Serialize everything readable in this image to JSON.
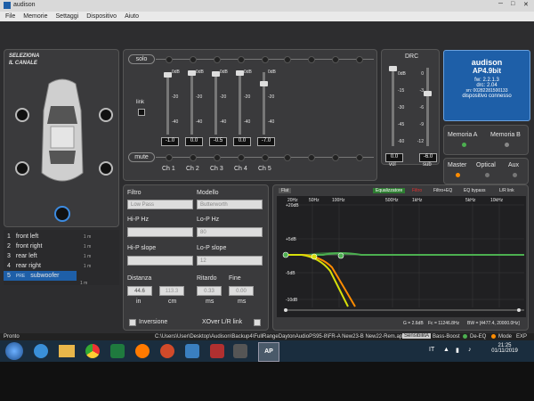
{
  "window": {
    "title": "audison"
  },
  "menu": [
    "File",
    "Memorie",
    "Settaggi",
    "Dispositivo",
    "Aiuto"
  ],
  "channel_select": {
    "title_line1": "SELEZIONA",
    "title_line2": "IL CANALE",
    "channels": [
      {
        "num": "1",
        "name": "front left",
        "meta": "1 m",
        "tag": "ch"
      },
      {
        "num": "2",
        "name": "front right",
        "meta": "1 m",
        "tag": "ch"
      },
      {
        "num": "3",
        "name": "rear left",
        "meta": "1 m",
        "tag": "ch"
      },
      {
        "num": "4",
        "name": "rear right",
        "meta": "1 m",
        "tag": "ch"
      },
      {
        "num": "5",
        "name": "subwoofer",
        "meta": "1 m",
        "tag": "ch",
        "prefix": "PRE"
      }
    ],
    "link_label": "link"
  },
  "mixer": {
    "solo_label": "solo",
    "mute_label": "mute",
    "link_label": "link",
    "scale": [
      "0dB",
      "-20",
      "-40"
    ],
    "channels": [
      {
        "label": "Ch 1",
        "value": "-1.0",
        "level": 0.97
      },
      {
        "label": "Ch 2",
        "value": "0.0",
        "level": 1.0
      },
      {
        "label": "Ch 3",
        "value": "-0.5",
        "level": 0.98
      },
      {
        "label": "Ch 4",
        "value": "0.0",
        "level": 1.0
      },
      {
        "label": "Ch 5",
        "value": "-7.0",
        "level": 0.83
      }
    ]
  },
  "drc": {
    "title": "DRC",
    "scale_left": [
      "0dB",
      "-15",
      "-30",
      "-45",
      "-60"
    ],
    "scale_right": [
      "0",
      "-3",
      "-6",
      "-9",
      "-12"
    ],
    "vol_value": "0.0",
    "sub_value": "-6.0",
    "vol_label": "vol",
    "sub_label": "sub"
  },
  "device": {
    "brand": "audison",
    "model": "AP4.9bit",
    "fw": "fw: 2.2.1.3",
    "drc": "drc: 2.04",
    "sn": "sn: 00282281500133",
    "status": "dispositivo connesso"
  },
  "memory": {
    "a": "Memoria A",
    "b": "Memoria B"
  },
  "input": {
    "master": "Master",
    "optical": "Optical",
    "aux": "Aux"
  },
  "filter": {
    "filtro_label": "Filtro",
    "filtro_value": "Low Pass",
    "modello_label": "Modello",
    "modello_value": "Butterworth",
    "hip_hz_label": "Hi-P Hz",
    "hip_hz_value": "",
    "lop_hz_label": "Lo-P Hz",
    "lop_hz_value": "80",
    "hip_slope_label": "Hi-P slope",
    "hip_slope_value": "",
    "lop_slope_label": "Lo-P slope",
    "lop_slope_value": "12",
    "distanza_label": "Distanza",
    "distanza_in": "44.6",
    "distanza_cm": "113.3",
    "in_label": "in",
    "cm_label": "cm",
    "ritardo_label": "Ritardo",
    "ritardo_value": "0.33",
    "fine_label": "Fine",
    "fine_value": "0.00",
    "ms_label": "ms",
    "inversione_label": "Inversione",
    "xover_label": "XOver L/R link"
  },
  "eq": {
    "tab_flat": "Flat",
    "equalizzatore": "Equalizzatore",
    "filtro": "Filtro",
    "filtro_eq": "Filtro+EQ",
    "eq_bypass": "EQ bypass",
    "lr_link": "L/R link",
    "y_labels": [
      "+20dB",
      "+5dB",
      "-5dB",
      "-10dB"
    ],
    "x_labels": [
      "20Hz",
      "50Hz",
      "100Hz",
      "500Hz",
      "1kHz",
      "5kHz",
      "10kHz"
    ],
    "readout_g": "G = 2.6dB",
    "readout_fc": "Fc = 11246.8Hz",
    "readout_bw": "BW = [4477.4, 20000.0Hz]"
  },
  "status": {
    "left": "Pronto",
    "path": "C:\\Users\\User\\Desktop\\Audison\\Backup4\\FullRangeDaytonAudioPS95-8\\FR-A New23-B New22-Rem.apx",
    "speedbtn": "SensibilitA",
    "bass_boost": "Bass-Boost",
    "de_eq": "De-EQ",
    "mode": "Mode",
    "exp": "EXP"
  },
  "taskbar": {
    "lang": "IT",
    "time": "21:25",
    "date": "01/11/2019"
  },
  "colors": {
    "accent_blue": "#1e5fa8",
    "green": "#4caf50",
    "orange": "#ff8c00",
    "yellow": "#d7e00a",
    "red": "#e03030"
  }
}
